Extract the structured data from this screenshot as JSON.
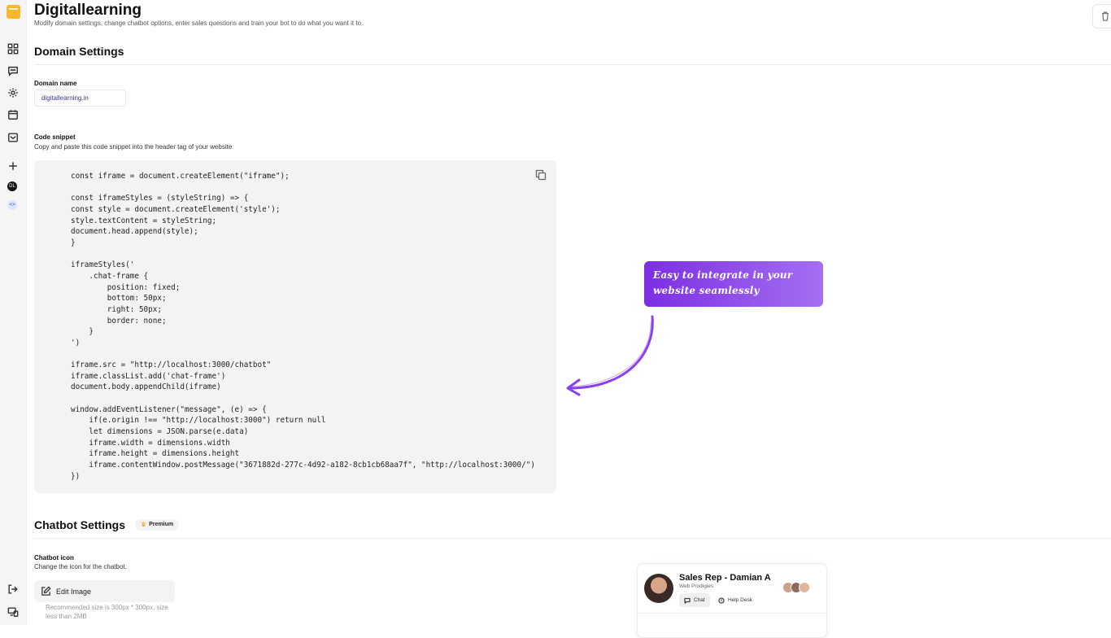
{
  "header": {
    "title": "Digitallearning",
    "subtitle": "Modify domain settings, change chatbot options, enter sales questions and train your bot to do what you want it to."
  },
  "sidebar": {
    "items": [
      {
        "icon": "dashboard-grid-icon"
      },
      {
        "icon": "chat-bubble-icon"
      },
      {
        "icon": "gear-icon"
      },
      {
        "icon": "calendar-icon"
      },
      {
        "icon": "inbox-icon"
      },
      {
        "icon": "plus-icon"
      }
    ],
    "domains": [
      {
        "initials": "DL"
      },
      {
        "initials": "<>"
      }
    ],
    "bottom": [
      {
        "icon": "sign-out-icon"
      },
      {
        "icon": "devices-icon"
      }
    ]
  },
  "domain_settings": {
    "title": "Domain Settings",
    "domain_name_label": "Domain name",
    "domain_name_value": "digitallearning.in",
    "code_snippet_label": "Code snippet",
    "code_snippet_help": "Copy and paste this code snippet into the header tag of your website",
    "code": "const iframe = document.createElement(\"iframe\");\n\nconst iframeStyles = (styleString) => {\nconst style = document.createElement('style');\nstyle.textContent = styleString;\ndocument.head.append(style);\n}\n\niframeStyles('\n    .chat-frame {\n        position: fixed;\n        bottom: 50px;\n        right: 50px;\n        border: none;\n    }\n')\n\niframe.src = \"http://localhost:3000/chatbot\"\niframe.classList.add('chat-frame')\ndocument.body.appendChild(iframe)\n\nwindow.addEventListener(\"message\", (e) => {\n    if(e.origin !== \"http://localhost:3000\") return null\n    let dimensions = JSON.parse(e.data)\n    iframe.width = dimensions.width\n    iframe.height = dimensions.height\n    iframe.contentWindow.postMessage(\"3671882d-277c-4d92-a182-8cb1cb68aa7f\", \"http://localhost:3000/\")\n})"
  },
  "callout": {
    "text": "Easy to integrate in your website seamlessly"
  },
  "chatbot_settings": {
    "title": "Chatbot Settings",
    "premium_badge": "Premium",
    "icon_label": "Chatbot icon",
    "icon_help": "Change the icon for the chatbot.",
    "edit_image_label": "Edit Image",
    "recommendation": "Recommended size is 300px * 300px, size less than 2MB"
  },
  "chat_preview": {
    "name": "Sales Rep - Damian A",
    "company": "Web Prodigies",
    "tabs": [
      "Chat",
      "Help Desk"
    ]
  },
  "colors": {
    "brand": "#f7b731",
    "callout_start": "#7c2ee4",
    "callout_end": "#a56ff0",
    "arrow": "#8a3ff0"
  }
}
